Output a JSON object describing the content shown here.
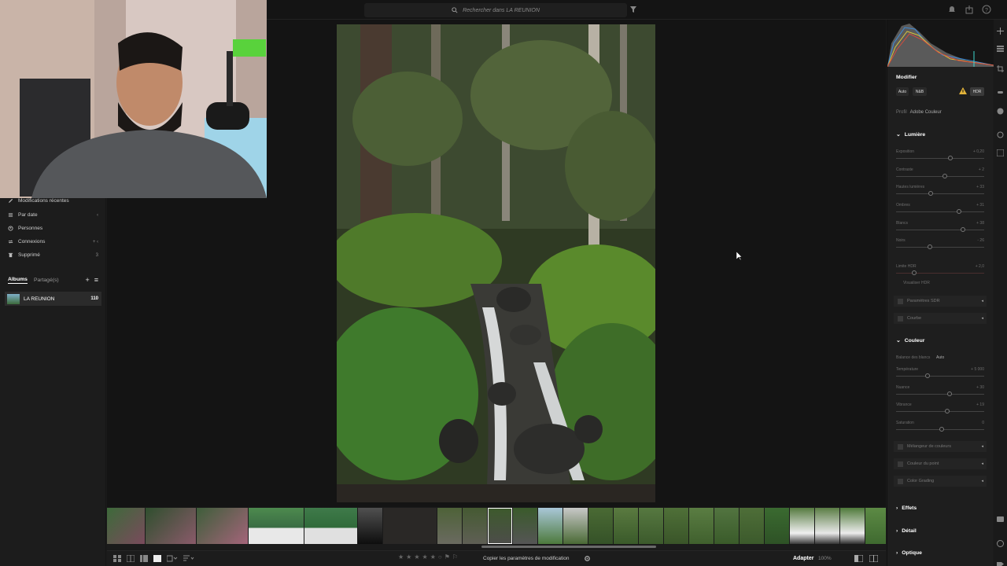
{
  "search": {
    "placeholder": "Rechercher dans LA REUNION"
  },
  "sidebar": {
    "items": [
      {
        "label": "Modifications récentes",
        "icon": "edit-recent-icon",
        "right": ""
      },
      {
        "label": "Par date",
        "icon": "calendar-icon",
        "right": "‹"
      },
      {
        "label": "Personnes",
        "icon": "people-icon",
        "right": ""
      },
      {
        "label": "Connexions",
        "icon": "connections-icon",
        "right": "+ ‹"
      },
      {
        "label": "Supprimé",
        "icon": "trash-icon",
        "right": "3"
      }
    ],
    "albums_tab": "Albums",
    "shared_tab": "Partagé(s)",
    "album": {
      "name": "LA REUNION",
      "count": "110"
    }
  },
  "bottombar": {
    "copy_params": "Copier les paramètres de modification",
    "fit": "Adapter",
    "zoom": "100%"
  },
  "rpanel": {
    "title": "Modifier",
    "auto": "Auto",
    "bw": "N&B",
    "hdr": "HDR",
    "profile_label": "Profil",
    "profile_value": "Adobe Couleur",
    "lumiere": "Lumière",
    "light_sliders": [
      {
        "label": "Exposition",
        "value": "+ 0,20",
        "pos": 0.62
      },
      {
        "label": "Contraste",
        "value": "+ 2",
        "pos": 0.55
      },
      {
        "label": "Hautes lumières",
        "value": "+ 33",
        "pos": 0.4
      },
      {
        "label": "Ombres",
        "value": "+ 31",
        "pos": 0.72
      },
      {
        "label": "Blancs",
        "value": "+ 38",
        "pos": 0.76
      },
      {
        "label": "Noirs",
        "value": "- 26",
        "pos": 0.38
      }
    ],
    "hdr_limit_label": "Limite HDR",
    "hdr_limit_value": "+ 2,0",
    "hdr_visualize": "Visualiser HDR",
    "sdr_params": "Paramètres SDR",
    "curves": "Courbe",
    "couleur": "Couleur",
    "wb_label": "Balance des blancs",
    "wb_value": "Auto",
    "color_sliders": [
      {
        "label": "Température",
        "value": "+ 5 000",
        "pos": 0.42
      },
      {
        "label": "Nuance",
        "value": "+ 30",
        "pos": 0.6
      },
      {
        "label": "Vibrance",
        "value": "+ 19",
        "pos": 0.58
      },
      {
        "label": "Saturation",
        "value": "0",
        "pos": 0.5
      }
    ],
    "color_mixer": "Mélangeur de couleurs",
    "point_color": "Couleur du point",
    "color_grading": "Color Grading",
    "effets": "Effets",
    "detail": "Détail",
    "optique": "Optique"
  }
}
